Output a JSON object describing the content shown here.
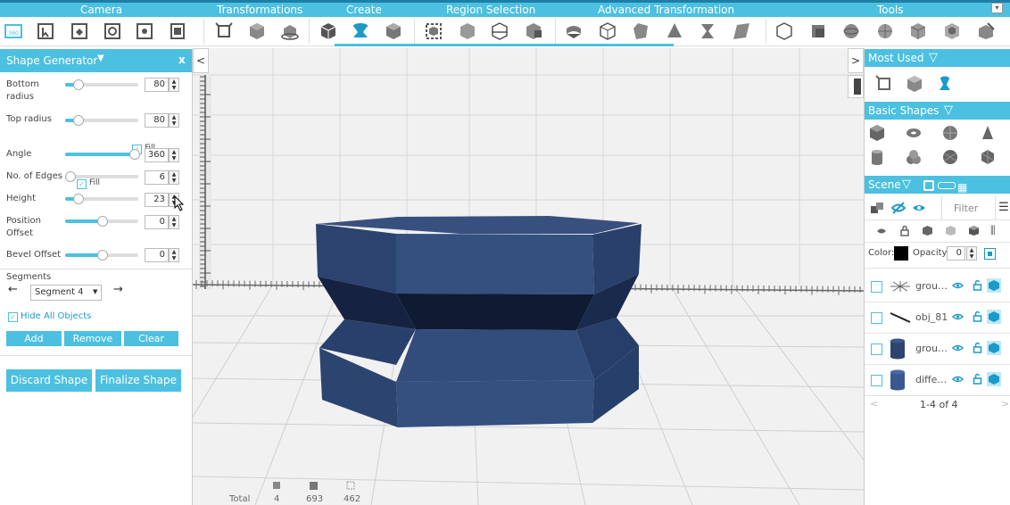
{
  "categories": [
    "Camera",
    "Transformations",
    "Create",
    "Region Selection",
    "Advanced Transformation",
    "Tools"
  ],
  "toolbar_icons": [
    "3d-view-icon",
    "select-region-icon",
    "paste-icon",
    "refresh-view-icon",
    "settings-view-icon",
    "clipboard-icon",
    "scale-icon",
    "move-box-icon",
    "rotate-box-icon",
    "cube-create-icon",
    "shape-generator-icon",
    "box-create-icon",
    "region-box-icon",
    "cube-region-icon",
    "plane-cut-icon",
    "split-box-icon",
    "bend-icon",
    "wire-box-icon",
    "skew-box-icon",
    "cone-taper-icon",
    "twist-icon",
    "shear-icon",
    "wire-cube-icon",
    "extrude-icon",
    "sphere-tool-icon",
    "globe-tool-icon",
    "cube-tool-icon",
    "group-tool-icon",
    "edit-box-icon"
  ],
  "shape_generator": {
    "title": "Shape Generator",
    "close": "x",
    "dropdown_arrow": "▼",
    "bottom_radius": {
      "label": "Bottom radius",
      "value": "80",
      "level": 0.17
    },
    "bottom_fill": "Fill",
    "top_radius": {
      "label": "Top radius",
      "value": "80",
      "level": 0.17
    },
    "top_fill": "Fill",
    "angle": {
      "label": "Angle",
      "value": "360",
      "level": 1.0
    },
    "edges": {
      "label": "No. of Edges",
      "value": "6",
      "level": 0.02
    },
    "height": {
      "label": "Height",
      "value": "23",
      "level": 0.17
    },
    "position_offset": {
      "label": "Position Offset",
      "value": "0",
      "level": 0.5
    },
    "bevel_offset": {
      "label": "Bevel Offset",
      "value": "0",
      "level": 0.5
    },
    "segments_label": "Segments",
    "segment_value": "Segment 4",
    "hide_all": "Hide All Objects",
    "add": "Add",
    "remove": "Remove",
    "clear": "Clear",
    "discard": "Discard Shape",
    "finalize": "Finalize Shape"
  },
  "viewport": {
    "collapse_left": "<",
    "expand_right": ">",
    "stats_labels": [
      "Total",
      "4",
      "693",
      "462"
    ]
  },
  "right_panel": {
    "most_used": "Most Used",
    "basic_shapes": "Basic Shapes",
    "scene": "Scene",
    "filter_placeholder": "Filter",
    "color_label": "Color:",
    "opacity_label": "Opacity:",
    "opacity_value": "0",
    "pagination": "1-4 of 4",
    "objects": [
      {
        "name": "grou…",
        "icon": "light-group-icon"
      },
      {
        "name": "obj_81",
        "icon": "line-object-icon"
      },
      {
        "name": "grou…",
        "icon": "cylinder-group-icon"
      },
      {
        "name": "diffe…",
        "icon": "cylinder-diff-icon"
      }
    ]
  },
  "colors": {
    "accent": "#4cc0e0",
    "accent_dark": "#1e7fa6",
    "shape_blue": "#2e4470",
    "shape_dark": "#111e3a"
  }
}
